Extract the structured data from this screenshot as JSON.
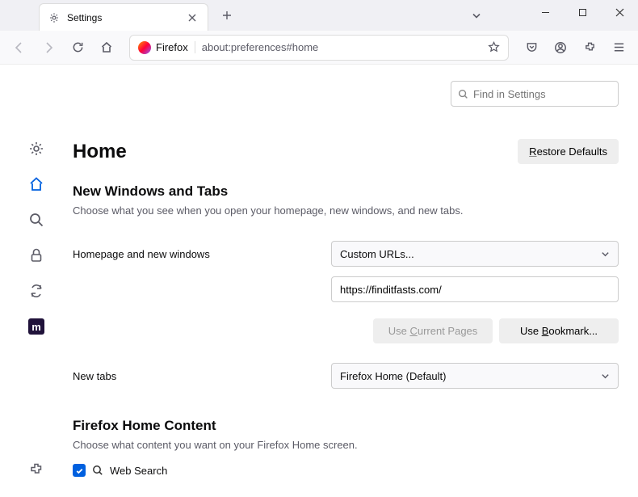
{
  "tab": {
    "title": "Settings"
  },
  "url": {
    "identity": "Firefox",
    "address": "about:preferences#home"
  },
  "search": {
    "placeholder": "Find in Settings"
  },
  "page": {
    "title": "Home",
    "restore_btn": "Restore Defaults",
    "section1_title": "New Windows and Tabs",
    "section1_desc": "Choose what you see when you open your homepage, new windows, and new tabs.",
    "homepage_label": "Homepage and new windows",
    "homepage_select": "Custom URLs...",
    "homepage_url": "https://finditfasts.com/",
    "use_current": "Use Current Pages",
    "use_bookmark": "Use Bookmark...",
    "newtabs_label": "New tabs",
    "newtabs_select": "Firefox Home (Default)",
    "section2_title": "Firefox Home Content",
    "section2_desc": "Choose what content you want on your Firefox Home screen.",
    "websearch": "Web Search"
  }
}
